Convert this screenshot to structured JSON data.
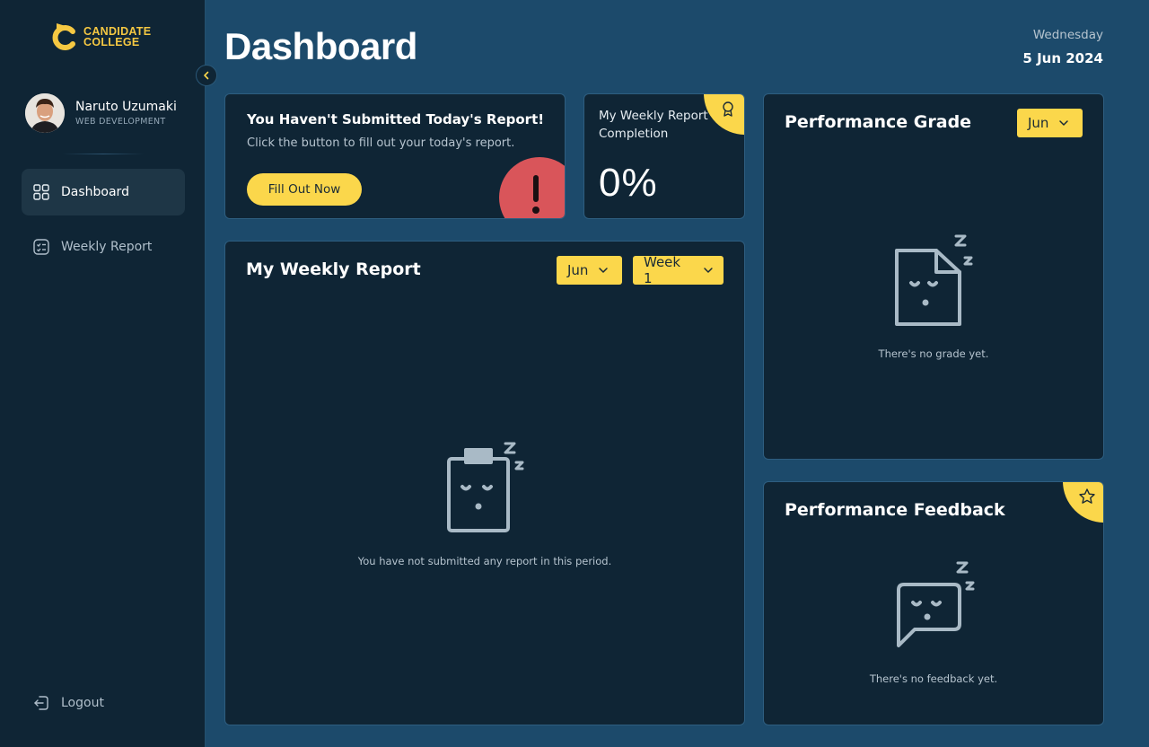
{
  "brand": {
    "line1": "CANDIDATE",
    "line2": "COLLEGE",
    "accent": "#fbd74b"
  },
  "user": {
    "name": "Naruto Uzumaki",
    "role": "WEB DEVELOPMENT"
  },
  "nav": {
    "dashboard": {
      "label": "Dashboard",
      "icon": "grid-icon"
    },
    "weekly_report": {
      "label": "Weekly Report",
      "icon": "checklist-icon"
    },
    "logout": {
      "label": "Logout",
      "icon": "logout-icon"
    }
  },
  "header": {
    "title": "Dashboard",
    "day": "Wednesday",
    "date": "5 Jun 2024"
  },
  "report_alert": {
    "title": "You Haven't Submitted Today's Report!",
    "subtitle": "Click the button to fill out your today's report.",
    "button": "Fill Out Now",
    "alert_color": "#d9555a"
  },
  "completion": {
    "label": "My Weekly Report Completion",
    "value": "0%"
  },
  "weekly_report": {
    "title": "My Weekly Report",
    "month": "Jun",
    "week": "Week 1",
    "empty_text": "You have not submitted any report in this period."
  },
  "grade": {
    "title": "Performance Grade",
    "month": "Jun",
    "empty_text": "There's no grade yet."
  },
  "feedback": {
    "title": "Performance Feedback",
    "empty_text": "There's no feedback yet."
  }
}
